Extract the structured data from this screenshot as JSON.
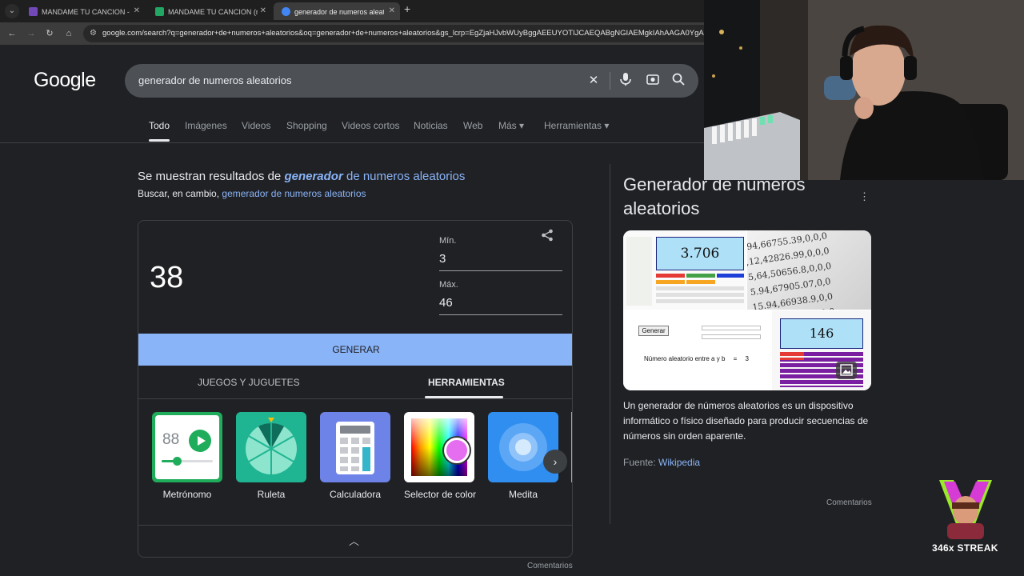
{
  "browser": {
    "tabs": [
      {
        "title": "MANDAME TU CANCION - Formularios de Google",
        "favicon_color": "#7248b9"
      },
      {
        "title": "MANDAME TU CANCION (respuestas)",
        "favicon_color": "#23a566"
      },
      {
        "title": "generador de numeros aleatorios - Buscar con Google",
        "favicon_color": "#4285f4"
      }
    ],
    "url": "google.com/search?q=generador+de+numeros+aleatorios&oq=generador+de+numeros+aleatorios&gs_lcrp=EgZjaHJvbWUyBggAEEUYOTIJCAEQABgNGIAEMgkIAhAAGA0YgAQyCQ"
  },
  "google": {
    "logo": "Google",
    "query": "generador de numeros aleatorios",
    "tabs": [
      "Todo",
      "Imágenes",
      "Videos",
      "Shopping",
      "Videos cortos",
      "Noticias",
      "Web",
      "Más",
      "Herramientas"
    ]
  },
  "spelling": {
    "prefix": "Se muestran resultados de",
    "corrected_bold": "generador",
    "corrected_rest": "de numeros aleatorios",
    "instead_prefix": "Buscar, en cambio,",
    "instead_link": "gemerador de numeros aleatorios"
  },
  "rng": {
    "result": "38",
    "min_label": "Mín.",
    "min_value": "3",
    "max_label": "Máx.",
    "max_value": "46",
    "generate_label": "GENERAR",
    "card_tabs": [
      "JUEGOS Y JUGUETES",
      "HERRAMIENTAS"
    ],
    "tools": [
      {
        "label": "Metrónomo",
        "icon_text": "88"
      },
      {
        "label": "Ruleta"
      },
      {
        "label": "Calculadora"
      },
      {
        "label": "Selector de color"
      },
      {
        "label": "Medita"
      }
    ],
    "comments": "Comentarios"
  },
  "knowledge_panel": {
    "title": "Generador de numeros aleatorios",
    "image_numbers": [
      "3.706",
      "146"
    ],
    "image_button": "Generar",
    "image_caption": "Número aleatorio entre a y b",
    "image_eq": "=",
    "image_value": "3",
    "description": "Un generador de números aleatorios es un dispositivo informático o físico diseñado para producir secuencias de números sin orden aparente.",
    "source_label": "Fuente:",
    "source_link": "Wikipedia",
    "comments": "Comentarios"
  },
  "overlay": {
    "streak": "346x STREAK"
  },
  "colors": {
    "background": "#202124",
    "accent": "#8ab4f8",
    "search_box": "#4d5156"
  }
}
